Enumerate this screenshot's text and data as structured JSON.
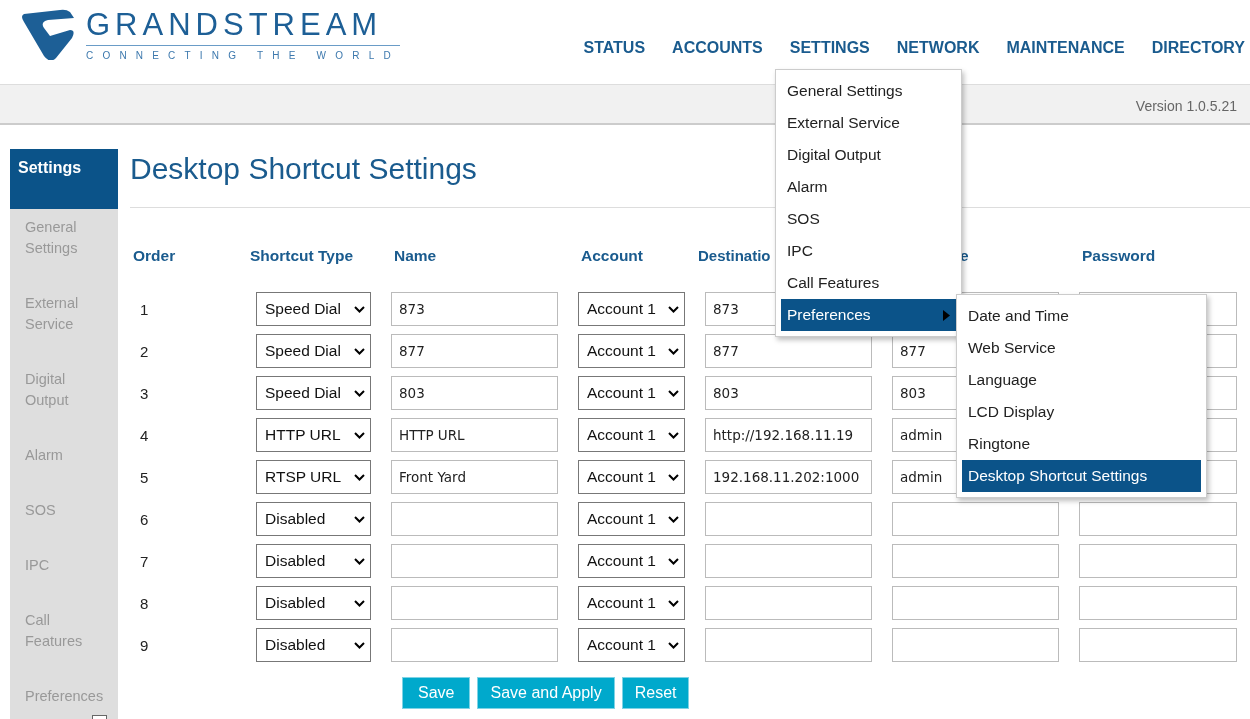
{
  "logo": {
    "name": "GRANDSTREAM",
    "tagline": "CONNECTING THE WORLD"
  },
  "nav": [
    {
      "label": "STATUS"
    },
    {
      "label": "ACCOUNTS"
    },
    {
      "label": "SETTINGS"
    },
    {
      "label": "NETWORK"
    },
    {
      "label": "MAINTENANCE"
    },
    {
      "label": "DIRECTORY"
    }
  ],
  "version": "Version 1.0.5.21",
  "sidebar": {
    "items": [
      {
        "label": "Settings",
        "selected": true
      },
      {
        "label": "General\nSettings",
        "selected": false
      },
      {
        "label": "External\nService",
        "selected": false
      },
      {
        "label": "Digital\nOutput",
        "selected": false
      },
      {
        "label": "Alarm",
        "selected": false
      },
      {
        "label": "SOS",
        "selected": false
      },
      {
        "label": "IPC",
        "selected": false
      },
      {
        "label": "Call\nFeatures",
        "selected": false
      },
      {
        "label": "Preferences",
        "selected": false
      }
    ]
  },
  "title": "Desktop Shortcut Settings",
  "table": {
    "columns": [
      "Order",
      "Shortcut Type",
      "Name",
      "Account",
      "Destinatio",
      "e",
      "Password"
    ],
    "rows": [
      {
        "order": "1",
        "type": "Speed Dial",
        "name": "873",
        "account": "Account 1",
        "destination": "873"
      },
      {
        "order": "2",
        "type": "Speed Dial",
        "name": "877",
        "account": "Account 1",
        "destination": "877",
        "username": "877"
      },
      {
        "order": "3",
        "type": "Speed Dial",
        "name": "803",
        "account": "Account 1",
        "destination": "803",
        "username": "803"
      },
      {
        "order": "4",
        "type": "HTTP URL",
        "name": "HTTP URL",
        "account": "Account 1",
        "destination": "http://192.168.11.19",
        "username": "admin"
      },
      {
        "order": "5",
        "type": "RTSP URL",
        "name": "Front Yard",
        "account": "Account 1",
        "destination": "192.168.11.202:1000",
        "username": "admin"
      },
      {
        "order": "6",
        "type": "Disabled",
        "account": "Account 1"
      },
      {
        "order": "7",
        "type": "Disabled",
        "account": "Account 1"
      },
      {
        "order": "8",
        "type": "Disabled",
        "account": "Account 1"
      },
      {
        "order": "9",
        "type": "Disabled",
        "account": "Account 1"
      }
    ]
  },
  "buttons": [
    {
      "label": "Save"
    },
    {
      "label": "Save and Apply"
    },
    {
      "label": "Reset"
    }
  ],
  "settings_menu": {
    "items": [
      {
        "label": "General Settings",
        "selected": false
      },
      {
        "label": "External Service",
        "selected": false
      },
      {
        "label": "Digital Output",
        "selected": false
      },
      {
        "label": "Alarm",
        "selected": false
      },
      {
        "label": "SOS",
        "selected": false
      },
      {
        "label": "IPC",
        "selected": false
      },
      {
        "label": "Call Features",
        "selected": false
      },
      {
        "label": "Preferences",
        "selected": true,
        "submenu": true
      }
    ]
  },
  "preferences_menu": {
    "items": [
      {
        "label": "Date and Time",
        "selected": false
      },
      {
        "label": "Web Service",
        "selected": false
      },
      {
        "label": "Language",
        "selected": false
      },
      {
        "label": "LCD Display",
        "selected": false
      },
      {
        "label": "Ringtone",
        "selected": false
      },
      {
        "label": "Desktop Shortcut Settings",
        "selected": true
      }
    ]
  }
}
